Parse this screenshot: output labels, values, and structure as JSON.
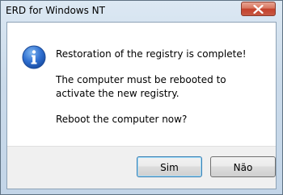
{
  "window": {
    "title": "ERD for Windows NT"
  },
  "message": {
    "line1": "Restoration of the registry is complete!",
    "line2": "The computer must be rebooted to activate the new registry.",
    "line3": "Reboot the computer now?"
  },
  "buttons": {
    "yes_label": "Sim",
    "no_label": "Não"
  },
  "icons": {
    "info": "info-icon",
    "close": "close-icon"
  }
}
